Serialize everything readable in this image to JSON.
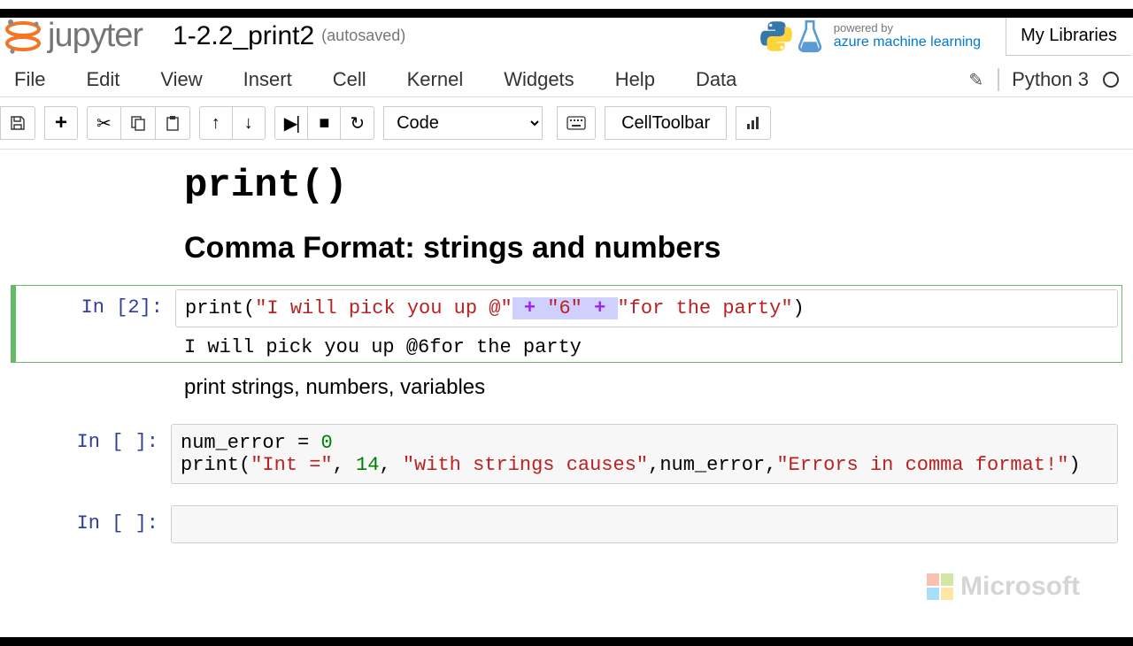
{
  "header": {
    "logo_text": "jupyter",
    "title": "1-2.2_print2",
    "autosave": "(autosaved)",
    "powered_line1": "powered by",
    "powered_line2": "azure machine learning",
    "my_libraries": "My Libraries"
  },
  "menu": {
    "file": "File",
    "edit": "Edit",
    "view": "View",
    "insert": "Insert",
    "cell": "Cell",
    "kernel": "Kernel",
    "widgets": "Widgets",
    "help": "Help",
    "data": "Data",
    "kernel_name": "Python 3"
  },
  "toolbar": {
    "cell_type": "Code",
    "celltoolbar": "CellToolbar"
  },
  "content": {
    "title_code": "print()",
    "section_heading": "Comma Format: strings and numbers",
    "md_text": "print strings, numbers, variables"
  },
  "cells": [
    {
      "prompt": "In [2]:",
      "code": {
        "fn": "print",
        "open": "(",
        "s1": "\"I will pick you up @\"",
        "sp1": " ",
        "op1": "+",
        "sp2": " ",
        "s2": "\"6\"",
        "sp3": " ",
        "op2": "+",
        "sp4": " ",
        "s3": "\"for the party\"",
        "close": ")"
      },
      "output": "I will pick you up @6for the party"
    },
    {
      "prompt": "In [ ]:",
      "line1": {
        "var": "num_error",
        "eq": " = ",
        "val": "0"
      },
      "line2": {
        "fn": "print",
        "open": "(",
        "s1": "\"Int =\"",
        "c1": ", ",
        "n1": "14",
        "c2": ", ",
        "s2": "\"with strings causes\"",
        "c3": ",",
        "var": "num_error",
        "c4": ",",
        "s3": "\"Errors in comma format!\"",
        "close": ")"
      }
    },
    {
      "prompt": "In [ ]:"
    }
  ],
  "footer": {
    "ms": "Microsoft"
  }
}
